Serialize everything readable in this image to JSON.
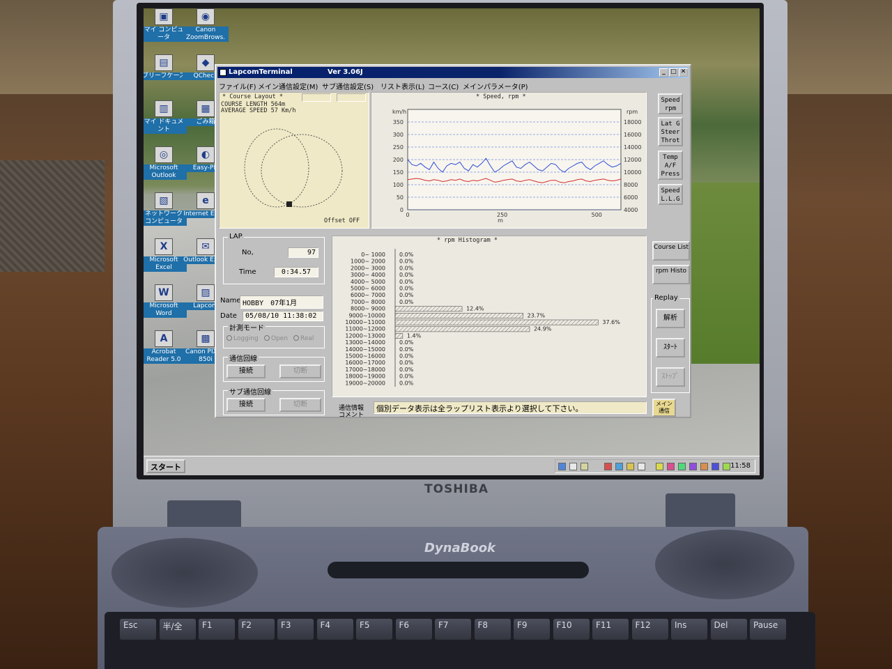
{
  "hardware": {
    "brand": "TOSHIBA",
    "model": "DynaBook"
  },
  "keyboard": [
    "Esc",
    "半/全",
    "F1",
    "F2",
    "F3",
    "F4",
    "F5",
    "F6",
    "F7",
    "F8",
    "F9",
    "F10",
    "F11",
    "F12",
    "Ins",
    "Del",
    "Pause"
  ],
  "desktop_icons": [
    {
      "label": "マイ コンピュータ",
      "glyph": "▣"
    },
    {
      "label": "Canon ZoomBrows.",
      "glyph": "◉"
    },
    {
      "label": "ブリーフケース",
      "glyph": "▤"
    },
    {
      "label": "QCheck",
      "glyph": "◆"
    },
    {
      "label": "マイ ドキュメント",
      "glyph": "▥"
    },
    {
      "label": "ごみ箱",
      "glyph": "▦"
    },
    {
      "label": "Microsoft Outlook",
      "glyph": "◎"
    },
    {
      "label": "Easy-PH",
      "glyph": "◐"
    },
    {
      "label": "ネットワーク コンピュータ",
      "glyph": "▧"
    },
    {
      "label": "Internet Explo",
      "glyph": "e"
    },
    {
      "label": "Microsoft Excel",
      "glyph": "X"
    },
    {
      "label": "Outlook Expre",
      "glyph": "✉"
    },
    {
      "label": "Microsoft Word",
      "glyph": "W"
    },
    {
      "label": "Lapcom",
      "glyph": "▨"
    },
    {
      "label": "Acrobat Reader 5.0",
      "glyph": "A"
    },
    {
      "label": "Canon PIXUS 850i",
      "glyph": "▩"
    }
  ],
  "taskbar": {
    "start_label": "スタート",
    "clock": "11:58"
  },
  "window": {
    "title": "LapcomTerminal",
    "version": "Ver 3.06J",
    "menu": [
      "ファイル(F)",
      "メイン通信設定(M)",
      "サブ通信設定(S)",
      "リスト表示(L)",
      "コース(C)",
      "メインパラメータ(P)"
    ]
  },
  "course": {
    "header": "* Course Layout *",
    "length_line": "COURSE LENGTH  564m",
    "speed_line": "AVERAGE SPEED  57 Km/h",
    "offset": "Offset OFF"
  },
  "speed_chart": {
    "title": "*  Speed, rpm  *",
    "left_unit": "km/h",
    "right_unit": "rpm",
    "xlabel": "m",
    "left_ticks": [
      "350",
      "300",
      "250",
      "200",
      "150",
      "100",
      "50",
      "0"
    ],
    "right_ticks": [
      "18000",
      "16000",
      "14000",
      "12000",
      "10000",
      "8000",
      "6000",
      "4000"
    ],
    "x_ticks": [
      "0",
      "250",
      "500"
    ]
  },
  "side_buttons": [
    {
      "label": "Speed rpm"
    },
    {
      "label": "Lat G Steer Throt"
    },
    {
      "label": "Temp A/F Press"
    },
    {
      "label": "Speed L.L.G"
    }
  ],
  "lap": {
    "title": "LAP",
    "no_label": "No,",
    "no_value": "97",
    "time_label": "Time",
    "time_value": "0:34.57"
  },
  "name_label": "Name",
  "name_value": "HOBBY　07年1月",
  "date_label": "Date",
  "date_value": "05/08/10 11:38:02",
  "mode": {
    "title": "計測モード",
    "options": [
      "Logging",
      "Open",
      "Real"
    ]
  },
  "main_line": {
    "title": "通信回線",
    "connect": "接続",
    "disconnect": "切断"
  },
  "sub_line": {
    "title": "サブ通信回線",
    "connect": "接続",
    "disconnect": "切断"
  },
  "info": {
    "label1": "通信情報",
    "label2": "コメント",
    "text": "個別データ表示は全ラップリスト表示より選択して下さい。",
    "main_button": "メイン 通信"
  },
  "right_buttons": {
    "course_list": "Course List",
    "rpm_histo": "rpm Histo",
    "replay_title": "Replay",
    "analyze": "解析",
    "start": "ｽﾀｰﾄ",
    "stop": "ｽﾄｯﾌﾟ"
  },
  "chart_data": {
    "type": "bar",
    "title": "*  rpm Histogram  *",
    "categories": [
      "0~ 1000",
      "1000~ 2000",
      "2000~ 3000",
      "3000~ 4000",
      "4000~ 5000",
      "5000~ 6000",
      "6000~ 7000",
      "7000~ 8000",
      "8000~ 9000",
      "9000~10000",
      "10000~11000",
      "11000~12000",
      "12000~13000",
      "13000~14000",
      "14000~15000",
      "15000~16000",
      "16000~17000",
      "17000~18000",
      "18000~19000",
      "19000~20000"
    ],
    "values": [
      0.0,
      0.0,
      0.0,
      0.0,
      0.0,
      0.0,
      0.0,
      0.0,
      12.4,
      23.7,
      37.6,
      24.9,
      1.4,
      0.0,
      0.0,
      0.0,
      0.0,
      0.0,
      0.0,
      0.0
    ],
    "value_labels": [
      "0.0%",
      "0.0%",
      "0.0%",
      "0.0%",
      "0.0%",
      "0.0%",
      "0.0%",
      "0.0%",
      "12.4%",
      "23.7%",
      "37.6%",
      "24.9%",
      "1.4%",
      "0.0%",
      "0.0%",
      "0.0%",
      "0.0%",
      "0.0%",
      "0.0%",
      "0.0%"
    ],
    "xlim": [
      0,
      40
    ],
    "orientation": "horizontal"
  },
  "speed_series": {
    "x_range": [
      0,
      564
    ],
    "speed_kmh": [
      200,
      180,
      175,
      185,
      170,
      160,
      190,
      165,
      150,
      175,
      185,
      180,
      190,
      165,
      155,
      180,
      170,
      185,
      205,
      175,
      150,
      160,
      175,
      185,
      195,
      170,
      165,
      180,
      190,
      175,
      160,
      155,
      170,
      185,
      180,
      160,
      150,
      165,
      175,
      185,
      190,
      170,
      160,
      175,
      185,
      195,
      180,
      170,
      175,
      185
    ],
    "rpm": [
      8800,
      8900,
      9000,
      8900,
      8700,
      8600,
      8800,
      8700,
      8500,
      8600,
      8800,
      8700,
      8900,
      8600,
      8500,
      8700,
      8600,
      8800,
      9000,
      8700,
      8400,
      8500,
      8700,
      8800,
      8900,
      8600,
      8500,
      8700,
      8800,
      8600,
      8400,
      8300,
      8500,
      8700,
      8700,
      8400,
      8300,
      8500,
      8600,
      8800,
      8900,
      8600,
      8500,
      8700,
      8800,
      8900,
      8700,
      8600,
      8700,
      8900
    ]
  }
}
